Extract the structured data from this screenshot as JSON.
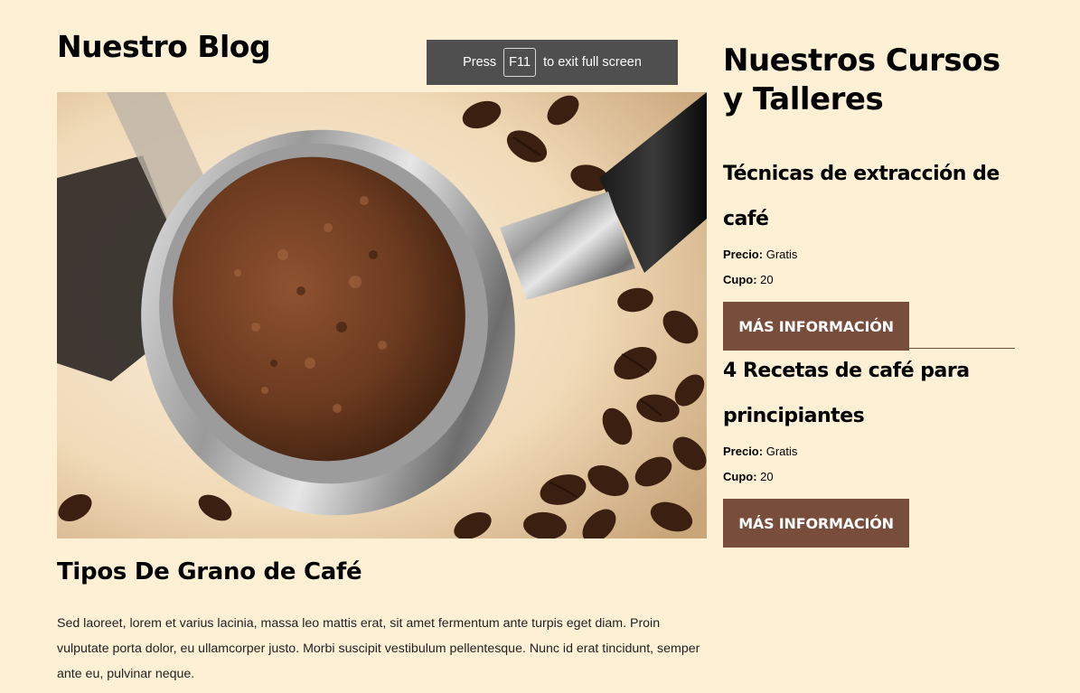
{
  "blog": {
    "heading": "Nuestro Blog",
    "post": {
      "title": "Tipos De Grano de Café",
      "body": "Sed laoreet, lorem et varius lacinia, massa leo mattis erat, sit amet fermentum ante turpis eget diam. Proin vulputate porta dolor, eu ullamcorper justo. Morbi suscipit vestibulum pellentesque. Nunc id erat tincidunt, semper ante eu, pulvinar neque."
    }
  },
  "sidebar": {
    "heading": "Nuestros Cursos y Talleres",
    "courses": [
      {
        "title": "Técnicas de extracción de café",
        "price_label": "Precio:",
        "price": "Gratis",
        "quota_label": "Cupo:",
        "quota": "20",
        "button": "MÁS INFORMACIÓN"
      },
      {
        "title": "4 Recetas de café para principiantes",
        "price_label": "Precio:",
        "price": "Gratis",
        "quota_label": "Cupo:",
        "quota": "20",
        "button": "MÁS INFORMACIÓN"
      }
    ]
  },
  "fullscreen_notice": {
    "prefix": "Press",
    "key": "F11",
    "suffix": "to exit full screen"
  },
  "colors": {
    "background": "#fdf0d5",
    "button": "#784d3c",
    "notice": "#4f4f4f"
  },
  "icons": {
    "hero_image": "espresso-portafilter-with-coffee-beans"
  }
}
